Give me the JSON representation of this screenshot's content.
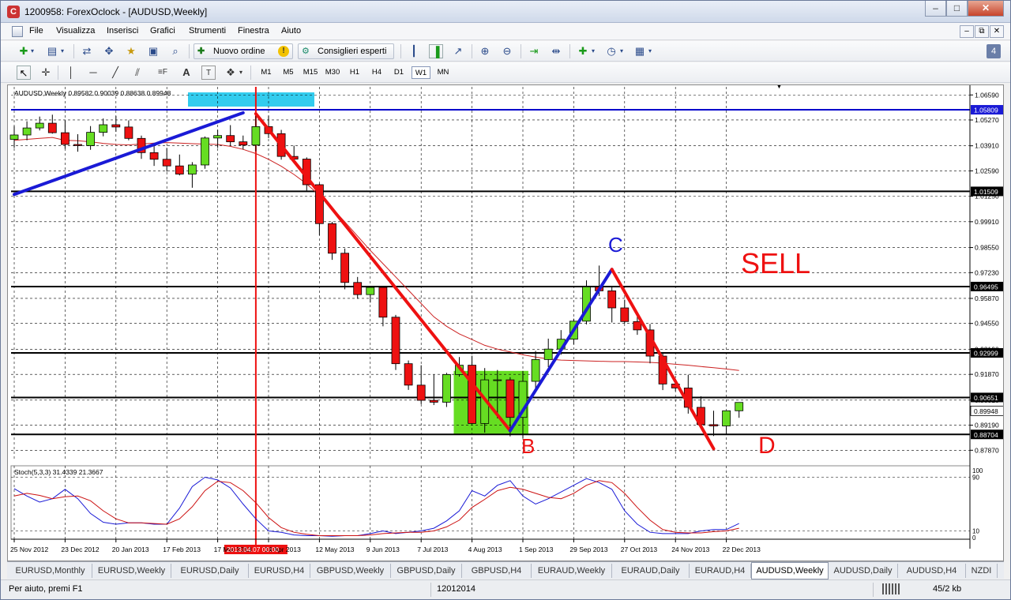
{
  "window": {
    "title": "1200958: ForexOclock - [AUDUSD,Weekly]",
    "icon": "app-c-icon",
    "controls": [
      "minimize",
      "maximize",
      "close"
    ]
  },
  "menu": {
    "items": [
      "File",
      "Visualizza",
      "Inserisci",
      "Grafici",
      "Strumenti",
      "Finestra",
      "Aiuto"
    ]
  },
  "toolbar1": {
    "new_order_label": "Nuovo ordine",
    "expert_advisors_label": "Consiglieri esperti"
  },
  "toolbar2": {
    "timeframes": [
      "M1",
      "M5",
      "M15",
      "M30",
      "H1",
      "H4",
      "D1",
      "W1",
      "MN"
    ],
    "active_timeframe": "W1"
  },
  "chart": {
    "header": "AUDUSD,Weekly  0.89582 0.90039 0.88638 0.89948",
    "symbol": "AUDUSD",
    "period": "Weekly",
    "ohlc": {
      "open": "0.89582",
      "high": "0.90039",
      "low": "0.88638",
      "close": "0.89948"
    },
    "price_ticks": [
      "1.06590",
      "1.05270",
      "1.03910",
      "1.02590",
      "1.01250",
      "0.99910",
      "0.98550",
      "0.97230",
      "0.95870",
      "0.94550",
      "0.93190",
      "0.91870",
      "0.90510",
      "0.89190",
      "0.87870"
    ],
    "price_tick_values": [
      1.0659,
      1.0527,
      1.0391,
      1.0259,
      1.0125,
      0.9991,
      0.9855,
      0.9723,
      0.9587,
      0.9455,
      0.9319,
      0.9187,
      0.9051,
      0.8919,
      0.8787
    ],
    "horizontal_levels": [
      {
        "label": "1.05809",
        "value": 1.05809,
        "color": "#0000cc",
        "highlight": true
      },
      {
        "label": "1.01509",
        "value": 1.01509,
        "color": "#000000",
        "highlight": false
      },
      {
        "label": "0.96495",
        "value": 0.96495,
        "color": "#000000",
        "highlight": false
      },
      {
        "label": "0.92999",
        "value": 0.92999,
        "color": "#000000",
        "highlight": false
      },
      {
        "label": "0.90651",
        "value": 0.90651,
        "color": "#000000",
        "highlight": false
      },
      {
        "label": "0.88704",
        "value": 0.88704,
        "color": "#000000",
        "highlight": false
      }
    ],
    "bid_label": "0.89948",
    "date_ticks": [
      "25 Nov 2012",
      "23 Dec 2012",
      "20 Jan 2013",
      "17 Feb 2013",
      "17 Mar 2013",
      "14 Apr 2013",
      "12 May 2013",
      "9 Jun 2013",
      "7 Jul 2013",
      "4 Aug 2013",
      "1 Sep 2013",
      "29 Sep 2013",
      "27 Oct 2013",
      "24 Nov 2013",
      "22 Dec 2013"
    ],
    "cursor_date_label": "2013.04.07 00:00",
    "annotations": {
      "sell": "SELL",
      "b": "B",
      "c": "C",
      "d": "D"
    },
    "stochastic_header": "Stoch(5,3,3) 31.4339 21.3667",
    "stochastic_ticks": [
      "100",
      "90",
      "10",
      "0"
    ],
    "colors": {
      "bull": "#66dd22",
      "bear": "#ee1111",
      "ma": "#cc2222",
      "blue_leg": "#1a1ad6",
      "red_leg": "#ee1111",
      "zone": "#66dd22",
      "top_zone": "#33ccee"
    }
  },
  "chart_data": {
    "type": "candlestick",
    "x": [
      "2012-11-25",
      "2012-12-02",
      "2012-12-09",
      "2012-12-16",
      "2012-12-23",
      "2012-12-30",
      "2013-01-06",
      "2013-01-13",
      "2013-01-20",
      "2013-01-27",
      "2013-02-03",
      "2013-02-10",
      "2013-02-17",
      "2013-02-24",
      "2013-03-03",
      "2013-03-10",
      "2013-03-17",
      "2013-03-24",
      "2013-03-31",
      "2013-04-07",
      "2013-04-14",
      "2013-04-21",
      "2013-04-28",
      "2013-05-05",
      "2013-05-12",
      "2013-05-19",
      "2013-05-26",
      "2013-06-02",
      "2013-06-09",
      "2013-06-16",
      "2013-06-23",
      "2013-06-30",
      "2013-07-07",
      "2013-07-14",
      "2013-07-21",
      "2013-07-28",
      "2013-08-04",
      "2013-08-11",
      "2013-08-18",
      "2013-08-25",
      "2013-09-01",
      "2013-09-08",
      "2013-09-15",
      "2013-09-22",
      "2013-09-29",
      "2013-10-06",
      "2013-10-13",
      "2013-10-20",
      "2013-10-27",
      "2013-11-03",
      "2013-11-10",
      "2013-11-17",
      "2013-11-24",
      "2013-12-01",
      "2013-12-08",
      "2013-12-15",
      "2013-12-22",
      "2013-12-29"
    ],
    "open": [
      1.0425,
      1.0448,
      1.0485,
      1.051,
      1.046,
      1.0398,
      1.0392,
      1.0462,
      1.0502,
      1.049,
      1.043,
      1.0355,
      1.032,
      1.0285,
      1.0242,
      1.029,
      1.0432,
      1.0445,
      1.0412,
      1.0395,
      1.0492,
      1.0455,
      1.0335,
      1.0321,
      1.0186,
      0.9981,
      0.9825,
      0.9671,
      0.9607,
      0.9645,
      0.9488,
      0.9243,
      0.913,
      0.905,
      0.904,
      0.9186,
      0.9235,
      0.8928,
      0.9158,
      0.9158,
      0.896,
      0.915,
      0.9265,
      0.932,
      0.9372,
      0.9467,
      0.9648,
      0.9627,
      0.9537,
      0.9465,
      0.9421,
      0.9283,
      0.9136,
      0.9115,
      0.9013,
      0.8922,
      0.8915,
      0.8995
    ],
    "high": [
      1.0495,
      1.052,
      1.0545,
      1.0555,
      1.0525,
      1.0452,
      1.0495,
      1.0535,
      1.0548,
      1.0525,
      1.0445,
      1.0395,
      1.038,
      1.0345,
      1.0305,
      1.044,
      1.0475,
      1.05,
      1.0445,
      1.056,
      1.055,
      1.0475,
      1.0392,
      1.033,
      1.0192,
      0.999,
      0.985,
      0.97,
      0.964,
      0.965,
      0.95,
      0.926,
      0.9235,
      0.9185,
      0.9195,
      0.9278,
      0.9285,
      0.922,
      0.921,
      0.9172,
      0.9205,
      0.931,
      0.9375,
      0.942,
      0.948,
      0.9682,
      0.976,
      0.9648,
      0.958,
      0.9495,
      0.9452,
      0.9296,
      0.9162,
      0.9185,
      0.9071,
      0.8995,
      0.8988,
      0.9025
    ],
    "low": [
      1.038,
      1.042,
      1.0472,
      1.0455,
      1.0375,
      1.036,
      1.037,
      1.0441,
      1.0465,
      1.042,
      1.0322,
      1.0285,
      1.0255,
      1.0235,
      1.017,
      1.027,
      1.038,
      1.0392,
      1.0372,
      1.0362,
      1.0432,
      1.0318,
      1.0305,
      1.0155,
      0.992,
      0.979,
      0.9635,
      0.9585,
      0.9565,
      0.944,
      0.921,
      0.9105,
      0.903,
      0.9025,
      0.9015,
      0.9175,
      0.8925,
      0.888,
      0.8955,
      0.886,
      0.885,
      0.911,
      0.9225,
      0.929,
      0.9345,
      0.945,
      0.96,
      0.946,
      0.9455,
      0.9395,
      0.9245,
      0.9104,
      0.9098,
      0.898,
      0.891,
      0.8862,
      0.887,
      0.8958
    ],
    "close": [
      1.0448,
      1.0485,
      1.051,
      1.046,
      1.0398,
      1.0392,
      1.0462,
      1.0502,
      1.049,
      1.043,
      1.0355,
      1.032,
      1.0285,
      1.0242,
      1.029,
      1.0432,
      1.0445,
      1.0412,
      1.0395,
      1.0492,
      1.0455,
      1.0335,
      1.0321,
      1.0186,
      0.9981,
      0.9825,
      0.9671,
      0.9607,
      0.9645,
      0.9488,
      0.9243,
      0.913,
      0.905,
      0.904,
      0.9186,
      0.9235,
      0.8928,
      0.9158,
      0.9158,
      0.896,
      0.915,
      0.9265,
      0.932,
      0.9372,
      0.9467,
      0.9648,
      0.9627,
      0.9537,
      0.9465,
      0.9421,
      0.9283,
      0.9136,
      0.9115,
      0.9013,
      0.8922,
      0.8915,
      0.8995,
      0.9039
    ],
    "ma": [
      1.042,
      1.0425,
      1.043,
      1.0435,
      1.042,
      1.0418,
      1.0412,
      1.0404,
      1.0398,
      1.0396,
      1.04,
      1.0405,
      1.0408,
      1.0405,
      1.0402,
      1.04,
      1.0398,
      1.0388,
      1.0372,
      1.035,
      1.032,
      1.0283,
      1.024,
      1.019,
      1.013,
      1.0063,
      0.999,
      0.9915,
      0.984,
      0.977,
      0.97,
      0.963,
      0.956,
      0.949,
      0.944,
      0.94,
      0.937,
      0.934,
      0.932,
      0.9305,
      0.929,
      0.9278,
      0.9268,
      0.9262,
      0.926,
      0.9258,
      0.9256,
      0.9254,
      0.9254,
      0.9252,
      0.925,
      0.9246,
      0.924,
      0.9235,
      0.9228,
      0.9222,
      0.9215,
      0.9207
    ],
    "stoch_k": [
      73,
      62,
      53,
      58,
      72,
      58,
      36,
      23,
      20,
      22,
      22,
      20,
      20,
      44,
      76,
      90,
      86,
      74,
      50,
      28,
      10,
      8,
      4,
      3,
      3,
      2,
      3,
      3,
      6,
      10,
      6,
      8,
      10,
      14,
      25,
      40,
      70,
      62,
      78,
      85,
      62,
      50,
      58,
      68,
      78,
      88,
      82,
      72,
      40,
      20,
      8,
      6,
      6,
      6,
      10,
      12,
      12,
      21
    ],
    "stoch_d": [
      62,
      66,
      63,
      58,
      61,
      62,
      55,
      40,
      28,
      22,
      22,
      21,
      20,
      28,
      46,
      70,
      84,
      82,
      70,
      52,
      30,
      15,
      8,
      5,
      3,
      3,
      3,
      3,
      4,
      6,
      7,
      8,
      8,
      10,
      16,
      26,
      45,
      57,
      70,
      75,
      72,
      66,
      60,
      58,
      66,
      78,
      85,
      82,
      66,
      45,
      26,
      12,
      8,
      7,
      7,
      9,
      10,
      14
    ]
  },
  "tabs": [
    "EURUSD,Monthly",
    "EURUSD,Weekly",
    "EURUSD,Daily",
    "EURUSD,H4",
    "GBPUSD,Weekly",
    "GBPUSD,Daily",
    "GBPUSD,H4",
    "EURAUD,Weekly",
    "EURAUD,Daily",
    "EURAUD,H4",
    "AUDUSD,Weekly",
    "AUDUSD,Daily",
    "AUDUSD,H4",
    "NZDI"
  ],
  "active_tab": "AUDUSD,Weekly",
  "status": {
    "help": "Per aiuto, premi F1",
    "profile": "12012014",
    "traffic": "45/2 kb"
  }
}
